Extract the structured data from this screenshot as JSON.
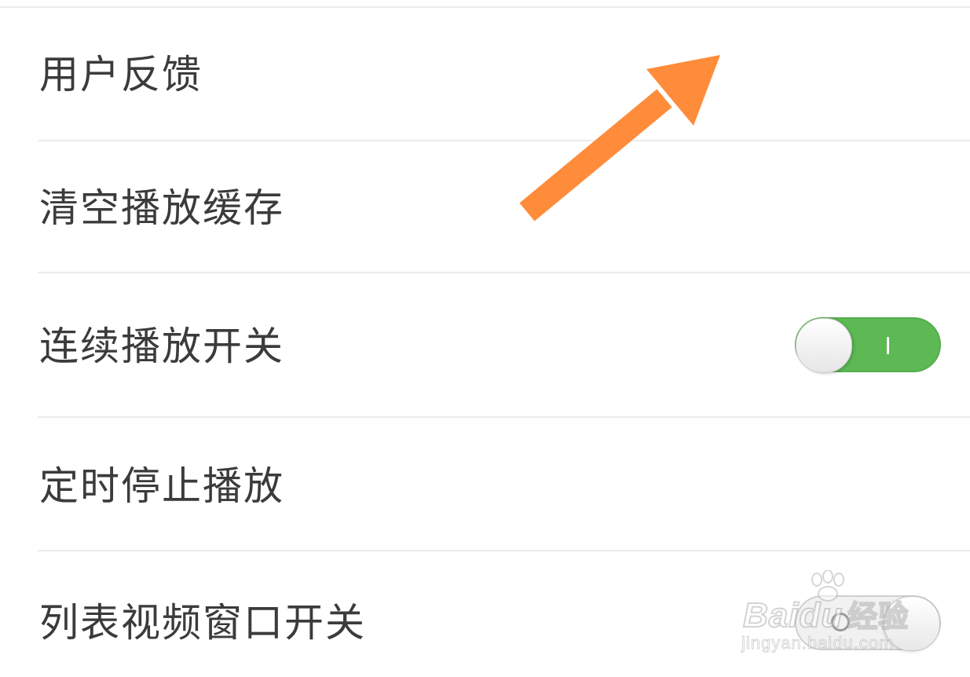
{
  "settings": {
    "items": [
      {
        "label": "用户反馈"
      },
      {
        "label": "清空播放缓存"
      },
      {
        "label": "连续播放开关",
        "toggle": "on"
      },
      {
        "label": "定时停止播放"
      },
      {
        "label": "列表视频窗口开关",
        "toggle": "off"
      }
    ]
  },
  "overlay": {
    "arrow_color": "#ff8c3a",
    "arrow_icon": "arrow-up-right-icon"
  },
  "watermark": {
    "brand_latin": "Bai",
    "brand_du": "du",
    "brand_cn": "经验",
    "url": "jingyan.baidu.com"
  },
  "colors": {
    "toggle_on": "#5cb954",
    "toggle_off": "#f1f1f1",
    "label_text": "#3b3b3b",
    "divider": "#ececec"
  }
}
